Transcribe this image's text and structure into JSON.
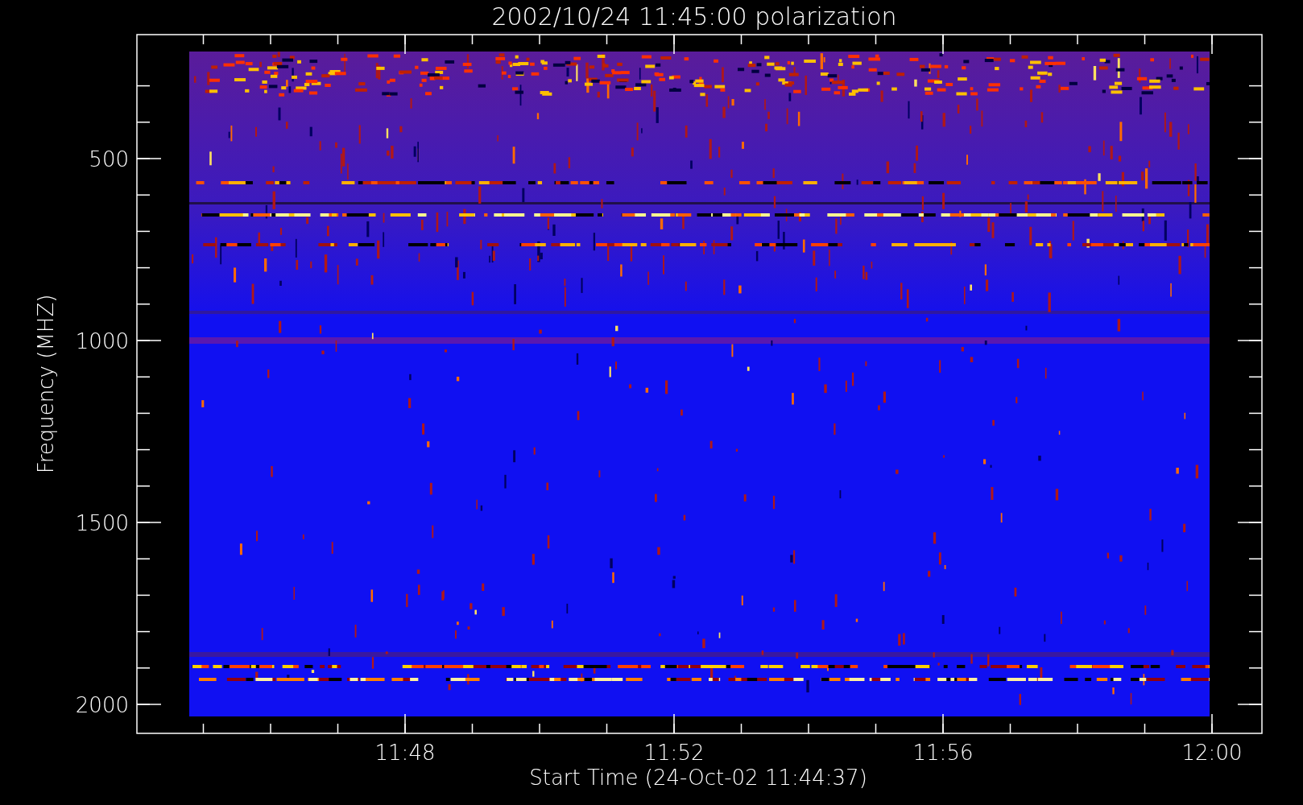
{
  "plot": {
    "title": "2002/10/24 11:45:00 polarization",
    "ylabel": "Frequency (MHZ)",
    "xlabel": "Start Time (24-Oct-02 11:44:37)",
    "yticks": [
      "500",
      "1000",
      "1500",
      "2000"
    ],
    "xticks": [
      "11:48",
      "11:52",
      "11:56",
      "12:00"
    ]
  }
}
